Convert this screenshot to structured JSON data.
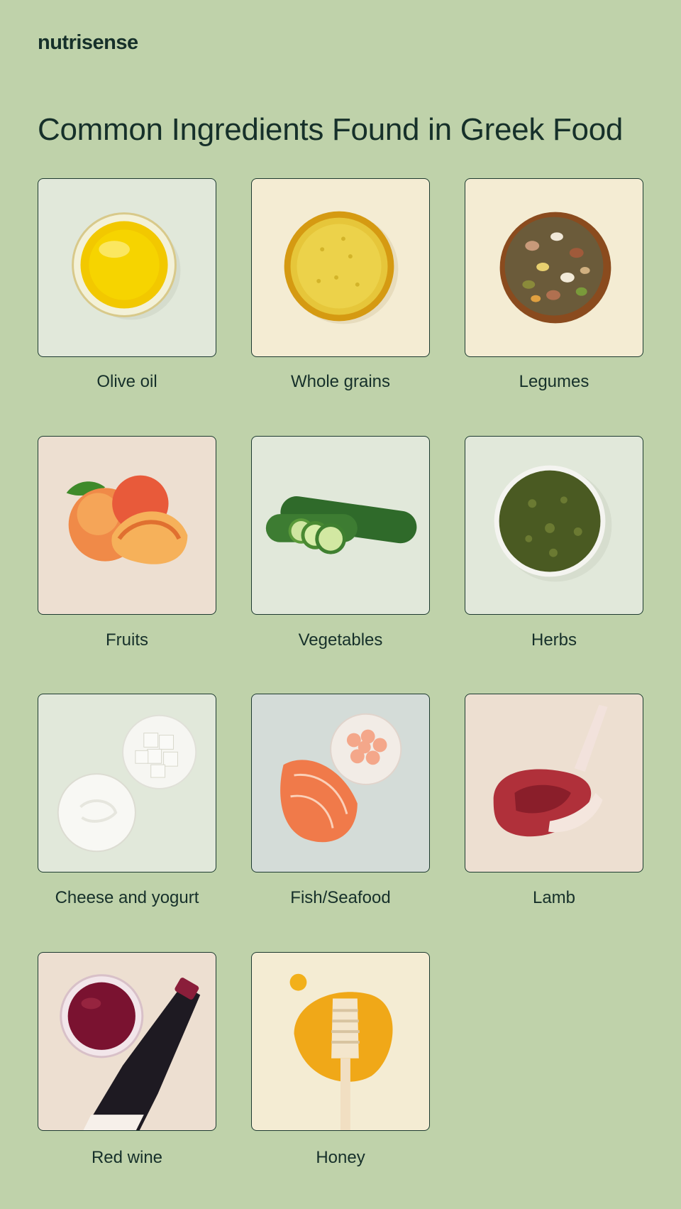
{
  "brand": {
    "name": "nutrisense"
  },
  "page_title": "Common Ingredients Found in Greek Food",
  "items": [
    {
      "label": "Olive oil",
      "image": "olive-oil-bowl",
      "bg": "#e1e8da"
    },
    {
      "label": "Whole grains",
      "image": "whole-grains-bowl",
      "bg": "#f4ecd3"
    },
    {
      "label": "Legumes",
      "image": "legumes-bowl",
      "bg": "#f4ecd3"
    },
    {
      "label": "Fruits",
      "image": "peaches",
      "bg": "#eddfd1"
    },
    {
      "label": "Vegetables",
      "image": "zucchini",
      "bg": "#e1e8da"
    },
    {
      "label": "Herbs",
      "image": "herbs-bowl",
      "bg": "#e1e8da"
    },
    {
      "label": "Cheese and yogurt",
      "image": "cheese-and-yogurt",
      "bg": "#e1e8da"
    },
    {
      "label": "Fish/Seafood",
      "image": "salmon-and-shrimp",
      "bg": "#d4dcd8"
    },
    {
      "label": "Lamb",
      "image": "lamb-rack",
      "bg": "#eddfd1"
    },
    {
      "label": "Red wine",
      "image": "red-wine",
      "bg": "#eddfd1"
    },
    {
      "label": "Honey",
      "image": "honey-dipper",
      "bg": "#f4ecd3"
    }
  ]
}
